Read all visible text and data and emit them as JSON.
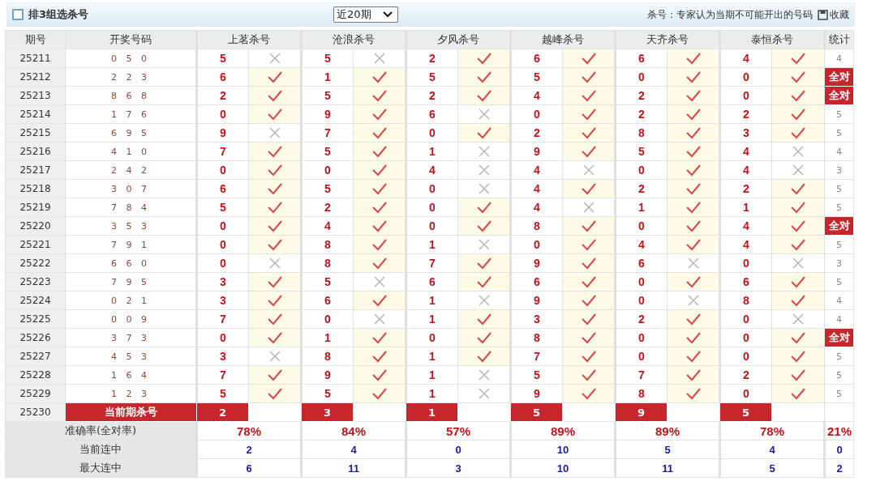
{
  "header": {
    "title": "排3组选杀号",
    "period_select": "近20期",
    "note": "杀号：专家认为当期不可能开出的号码",
    "bookmark": "收藏"
  },
  "columns": [
    "期号",
    "开奖号码",
    "上茗杀号",
    "沧浪杀号",
    "夕风杀号",
    "越峰杀号",
    "天齐杀号",
    "泰恒杀号",
    "统计"
  ],
  "rows": [
    {
      "period": "25211",
      "draw": "0 5 0",
      "picks": [
        {
          "number": "5",
          "hit": false
        },
        {
          "number": "5",
          "hit": false
        },
        {
          "number": "2",
          "hit": true
        },
        {
          "number": "6",
          "hit": true
        },
        {
          "number": "6",
          "hit": true
        },
        {
          "number": "4",
          "hit": true
        }
      ],
      "stat": {
        "text": "4",
        "all_correct": false
      }
    },
    {
      "period": "25212",
      "draw": "2 2 3",
      "picks": [
        {
          "number": "6",
          "hit": true
        },
        {
          "number": "1",
          "hit": true
        },
        {
          "number": "5",
          "hit": true
        },
        {
          "number": "5",
          "hit": true
        },
        {
          "number": "0",
          "hit": true
        },
        {
          "number": "0",
          "hit": true
        }
      ],
      "stat": {
        "text": "全对",
        "all_correct": true
      }
    },
    {
      "period": "25213",
      "draw": "8 6 8",
      "picks": [
        {
          "number": "2",
          "hit": true
        },
        {
          "number": "5",
          "hit": true
        },
        {
          "number": "2",
          "hit": true
        },
        {
          "number": "4",
          "hit": true
        },
        {
          "number": "2",
          "hit": true
        },
        {
          "number": "0",
          "hit": true
        }
      ],
      "stat": {
        "text": "全对",
        "all_correct": true
      }
    },
    {
      "period": "25214",
      "draw": "1 7 6",
      "picks": [
        {
          "number": "0",
          "hit": true
        },
        {
          "number": "9",
          "hit": true
        },
        {
          "number": "6",
          "hit": false
        },
        {
          "number": "0",
          "hit": true
        },
        {
          "number": "2",
          "hit": true
        },
        {
          "number": "2",
          "hit": true
        }
      ],
      "stat": {
        "text": "5",
        "all_correct": false
      }
    },
    {
      "period": "25215",
      "draw": "6 9 5",
      "picks": [
        {
          "number": "9",
          "hit": false
        },
        {
          "number": "7",
          "hit": true
        },
        {
          "number": "0",
          "hit": true
        },
        {
          "number": "2",
          "hit": true
        },
        {
          "number": "8",
          "hit": true
        },
        {
          "number": "3",
          "hit": true
        }
      ],
      "stat": {
        "text": "5",
        "all_correct": false
      }
    },
    {
      "period": "25216",
      "draw": "4 1 0",
      "picks": [
        {
          "number": "7",
          "hit": true
        },
        {
          "number": "5",
          "hit": true
        },
        {
          "number": "1",
          "hit": false
        },
        {
          "number": "9",
          "hit": true
        },
        {
          "number": "5",
          "hit": true
        },
        {
          "number": "4",
          "hit": false
        }
      ],
      "stat": {
        "text": "4",
        "all_correct": false
      }
    },
    {
      "period": "25217",
      "draw": "2 4 2",
      "picks": [
        {
          "number": "0",
          "hit": true
        },
        {
          "number": "0",
          "hit": true
        },
        {
          "number": "4",
          "hit": false
        },
        {
          "number": "4",
          "hit": false
        },
        {
          "number": "0",
          "hit": true
        },
        {
          "number": "4",
          "hit": false
        }
      ],
      "stat": {
        "text": "3",
        "all_correct": false
      }
    },
    {
      "period": "25218",
      "draw": "3 0 7",
      "picks": [
        {
          "number": "6",
          "hit": true
        },
        {
          "number": "5",
          "hit": true
        },
        {
          "number": "0",
          "hit": false
        },
        {
          "number": "4",
          "hit": true
        },
        {
          "number": "2",
          "hit": true
        },
        {
          "number": "2",
          "hit": true
        }
      ],
      "stat": {
        "text": "5",
        "all_correct": false
      }
    },
    {
      "period": "25219",
      "draw": "7 8 4",
      "picks": [
        {
          "number": "5",
          "hit": true
        },
        {
          "number": "2",
          "hit": true
        },
        {
          "number": "0",
          "hit": true
        },
        {
          "number": "4",
          "hit": false
        },
        {
          "number": "1",
          "hit": true
        },
        {
          "number": "1",
          "hit": true
        }
      ],
      "stat": {
        "text": "5",
        "all_correct": false
      }
    },
    {
      "period": "25220",
      "draw": "3 5 3",
      "picks": [
        {
          "number": "0",
          "hit": true
        },
        {
          "number": "4",
          "hit": true
        },
        {
          "number": "0",
          "hit": true
        },
        {
          "number": "8",
          "hit": true
        },
        {
          "number": "0",
          "hit": true
        },
        {
          "number": "4",
          "hit": true
        }
      ],
      "stat": {
        "text": "全对",
        "all_correct": true
      }
    },
    {
      "period": "25221",
      "draw": "7 9 1",
      "picks": [
        {
          "number": "0",
          "hit": true
        },
        {
          "number": "8",
          "hit": true
        },
        {
          "number": "1",
          "hit": false
        },
        {
          "number": "0",
          "hit": true
        },
        {
          "number": "4",
          "hit": true
        },
        {
          "number": "4",
          "hit": true
        }
      ],
      "stat": {
        "text": "5",
        "all_correct": false
      }
    },
    {
      "period": "25222",
      "draw": "6 6 0",
      "picks": [
        {
          "number": "0",
          "hit": false
        },
        {
          "number": "8",
          "hit": true
        },
        {
          "number": "7",
          "hit": true
        },
        {
          "number": "9",
          "hit": true
        },
        {
          "number": "6",
          "hit": false
        },
        {
          "number": "0",
          "hit": false
        }
      ],
      "stat": {
        "text": "3",
        "all_correct": false
      }
    },
    {
      "period": "25223",
      "draw": "7 9 5",
      "picks": [
        {
          "number": "3",
          "hit": true
        },
        {
          "number": "5",
          "hit": false
        },
        {
          "number": "6",
          "hit": true
        },
        {
          "number": "6",
          "hit": true
        },
        {
          "number": "0",
          "hit": true
        },
        {
          "number": "6",
          "hit": true
        }
      ],
      "stat": {
        "text": "5",
        "all_correct": false
      }
    },
    {
      "period": "25224",
      "draw": "0 2 1",
      "picks": [
        {
          "number": "3",
          "hit": true
        },
        {
          "number": "6",
          "hit": true
        },
        {
          "number": "1",
          "hit": false
        },
        {
          "number": "9",
          "hit": true
        },
        {
          "number": "0",
          "hit": false
        },
        {
          "number": "8",
          "hit": true
        }
      ],
      "stat": {
        "text": "4",
        "all_correct": false
      }
    },
    {
      "period": "25225",
      "draw": "0 0 9",
      "picks": [
        {
          "number": "7",
          "hit": true
        },
        {
          "number": "0",
          "hit": false
        },
        {
          "number": "1",
          "hit": true
        },
        {
          "number": "3",
          "hit": true
        },
        {
          "number": "2",
          "hit": true
        },
        {
          "number": "0",
          "hit": false
        }
      ],
      "stat": {
        "text": "4",
        "all_correct": false
      }
    },
    {
      "period": "25226",
      "draw": "3 7 3",
      "picks": [
        {
          "number": "0",
          "hit": true
        },
        {
          "number": "1",
          "hit": true
        },
        {
          "number": "0",
          "hit": true
        },
        {
          "number": "8",
          "hit": true
        },
        {
          "number": "0",
          "hit": true
        },
        {
          "number": "0",
          "hit": true
        }
      ],
      "stat": {
        "text": "全对",
        "all_correct": true
      }
    },
    {
      "period": "25227",
      "draw": "4 5 3",
      "picks": [
        {
          "number": "3",
          "hit": false
        },
        {
          "number": "8",
          "hit": true
        },
        {
          "number": "1",
          "hit": true
        },
        {
          "number": "7",
          "hit": true
        },
        {
          "number": "0",
          "hit": true
        },
        {
          "number": "0",
          "hit": true
        }
      ],
      "stat": {
        "text": "5",
        "all_correct": false
      }
    },
    {
      "period": "25228",
      "draw": "1 6 4",
      "picks": [
        {
          "number": "7",
          "hit": true
        },
        {
          "number": "9",
          "hit": true
        },
        {
          "number": "1",
          "hit": false
        },
        {
          "number": "5",
          "hit": true
        },
        {
          "number": "7",
          "hit": true
        },
        {
          "number": "2",
          "hit": true
        }
      ],
      "stat": {
        "text": "5",
        "all_correct": false
      }
    },
    {
      "period": "25229",
      "draw": "1 2 3",
      "picks": [
        {
          "number": "5",
          "hit": true
        },
        {
          "number": "5",
          "hit": true
        },
        {
          "number": "1",
          "hit": false
        },
        {
          "number": "9",
          "hit": true
        },
        {
          "number": "8",
          "hit": true
        },
        {
          "number": "0",
          "hit": true
        }
      ],
      "stat": {
        "text": "5",
        "all_correct": false
      }
    }
  ],
  "current": {
    "period": "25230",
    "label": "当前期杀号",
    "picks": [
      "2",
      "3",
      "1",
      "5",
      "9",
      "5"
    ]
  },
  "summary": [
    {
      "label": "准确率(全对率)",
      "kind": "rate",
      "values": [
        "78%",
        "84%",
        "57%",
        "89%",
        "89%",
        "78%"
      ],
      "total": "21%"
    },
    {
      "label": "当前连中",
      "kind": "streak",
      "values": [
        "2",
        "4",
        "0",
        "10",
        "5",
        "4"
      ],
      "total": "0"
    },
    {
      "label": "最大连中",
      "kind": "streak",
      "values": [
        "6",
        "11",
        "3",
        "10",
        "11",
        "5"
      ],
      "total": "2"
    }
  ]
}
